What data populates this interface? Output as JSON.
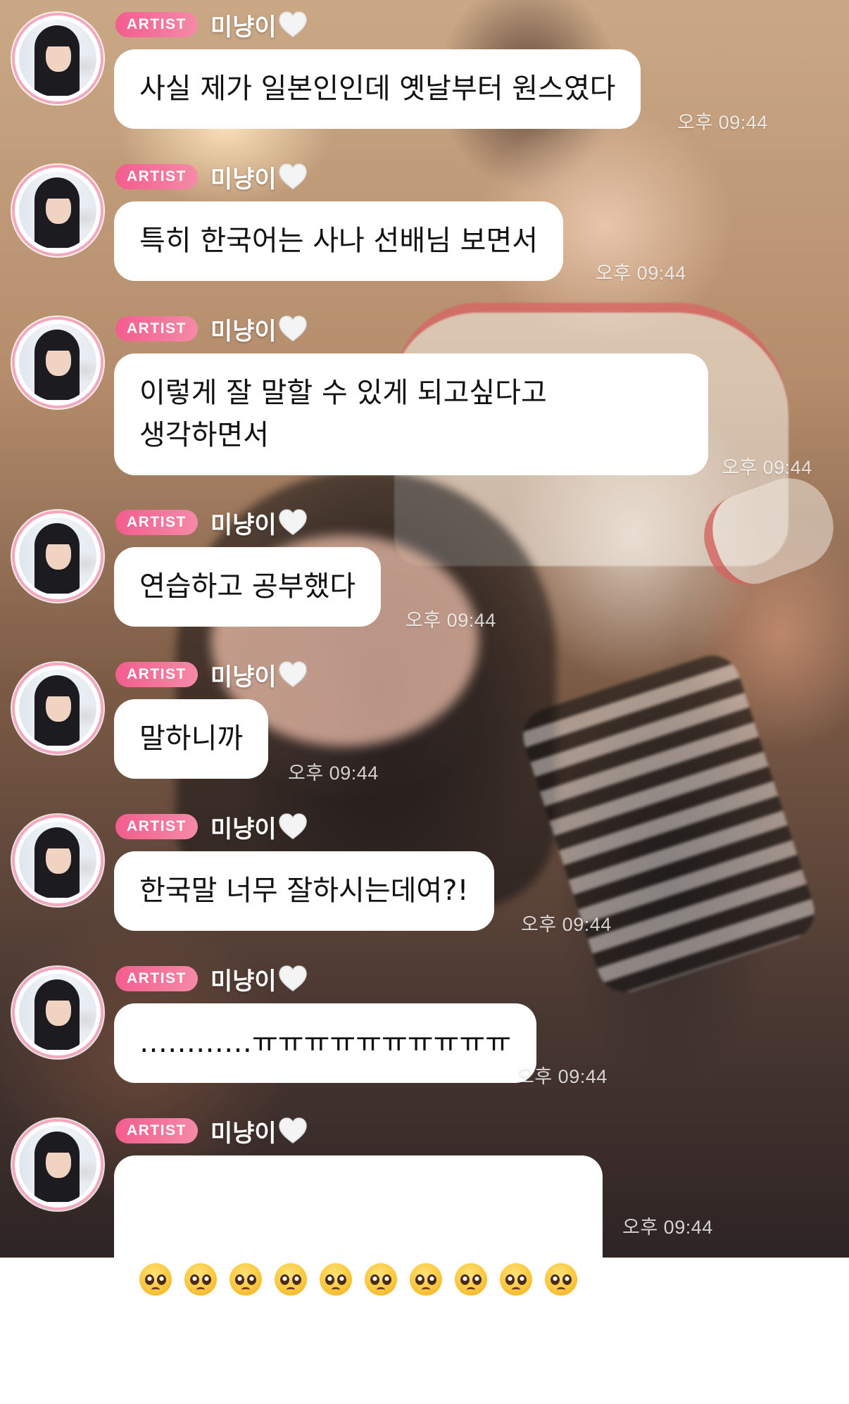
{
  "colors": {
    "badge": "#f35d8e",
    "avatar_ring": "#f3a8c0",
    "bubble": "#ffffff",
    "text": "#111111",
    "username": "#ffffff"
  },
  "messages": [
    {
      "badge": "ARTIST",
      "username": "미냥이",
      "heart_icon": "white-heart-icon",
      "text": "사실 제가 일본인인데 옛날부터 원스였다",
      "time": "오후 09:44"
    },
    {
      "badge": "ARTIST",
      "username": "미냥이",
      "heart_icon": "white-heart-icon",
      "text": "특히 한국어는 사나 선배님 보면서",
      "time": "오후 09:44"
    },
    {
      "badge": "ARTIST",
      "username": "미냥이",
      "heart_icon": "white-heart-icon",
      "text": "이렇게 잘 말할 수 있게 되고싶다고 생각하면서",
      "time": "오후 09:44"
    },
    {
      "badge": "ARTIST",
      "username": "미냥이",
      "heart_icon": "white-heart-icon",
      "text": "연습하고 공부했다",
      "time": "오후 09:44"
    },
    {
      "badge": "ARTIST",
      "username": "미냥이",
      "heart_icon": "white-heart-icon",
      "text": "말하니까",
      "time": "오후 09:44"
    },
    {
      "badge": "ARTIST",
      "username": "미냥이",
      "heart_icon": "white-heart-icon",
      "text": "한국말 너무 잘하시는데여?!",
      "time": "오후 09:44"
    },
    {
      "badge": "ARTIST",
      "username": "미냥이",
      "heart_icon": "white-heart-icon",
      "text": "…………ㅠㅠㅠㅠㅠㅠㅠㅠㅠㅠ",
      "time": "오후 09:44"
    },
    {
      "badge": "ARTIST",
      "username": "미냥이",
      "heart_icon": "white-heart-icon",
      "emoji": "🥺",
      "emoji_count": 10,
      "time": "오후 09:44"
    }
  ]
}
